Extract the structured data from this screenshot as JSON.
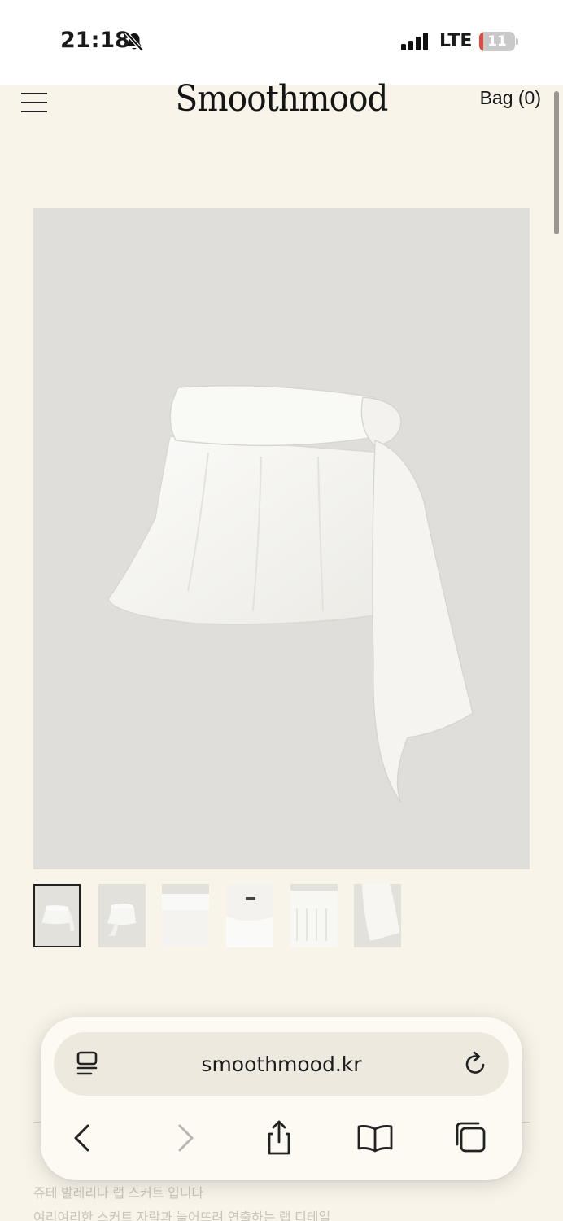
{
  "status_bar": {
    "time": "21:18",
    "network": "LTE",
    "battery": "11",
    "battery_level": 0.11,
    "icons": [
      "bell-slash-icon",
      "cellular-signal-icon",
      "battery-icon"
    ]
  },
  "header": {
    "logo": "Smoothmood",
    "bag_label": "Bag (0)",
    "menu_icon": "hamburger-menu-icon"
  },
  "product": {
    "thumbnail_count": 6,
    "selected_thumbnail": 1
  },
  "hidden_text": {
    "line1": "쥬테 발레리나 랩 스커트 입니다",
    "line2": "여리여리한 스커트 자락과 늘어뜨려 연출하는 랩 디테일"
  },
  "browser": {
    "url": "smoothmood.kr",
    "icons": [
      "page-format-icon",
      "reload-icon",
      "back-icon",
      "forward-icon",
      "share-icon",
      "bookmarks-icon",
      "tabs-icon"
    ]
  },
  "colors": {
    "page_background": "#f8f4ea",
    "image_background": "#e0deda",
    "battery_red": "#e3483f"
  }
}
